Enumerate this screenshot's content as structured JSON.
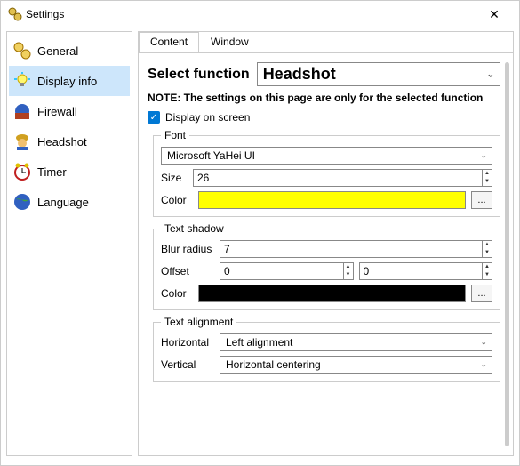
{
  "window": {
    "title": "Settings"
  },
  "sidebar": {
    "items": [
      {
        "label": "General"
      },
      {
        "label": "Display info"
      },
      {
        "label": "Firewall"
      },
      {
        "label": "Headshot"
      },
      {
        "label": "Timer"
      },
      {
        "label": "Language"
      }
    ],
    "selectedIndex": 1
  },
  "tabs": {
    "items": [
      {
        "label": "Content"
      },
      {
        "label": "Window"
      }
    ],
    "activeIndex": 0
  },
  "function_select": {
    "label": "Select function",
    "value": "Headshot"
  },
  "note": "NOTE: The settings on this page are only for the selected function",
  "display_checkbox": {
    "checked": true,
    "label": "Display on screen"
  },
  "font_group": {
    "legend": "Font",
    "font_value": "Microsoft YaHei UI",
    "size_label": "Size",
    "size_value": "26",
    "color_label": "Color",
    "color_value": "#ffff00"
  },
  "shadow_group": {
    "legend": "Text shadow",
    "blur_label": "Blur radius",
    "blur_value": "7",
    "offset_label": "Offset",
    "offset_x": "0",
    "offset_y": "0",
    "color_label": "Color",
    "color_value": "#000000"
  },
  "align_group": {
    "legend": "Text alignment",
    "horiz_label": "Horizontal",
    "horiz_value": "Left alignment",
    "vert_label": "Vertical",
    "vert_value": "Horizontal centering"
  },
  "ellipsis": "..."
}
